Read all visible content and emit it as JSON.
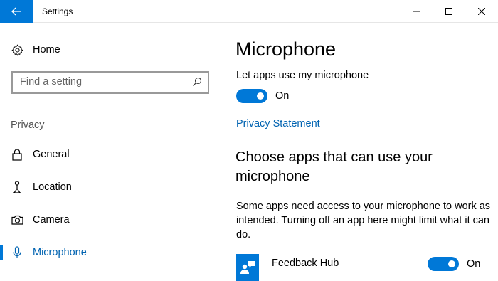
{
  "window": {
    "title": "Settings",
    "back_icon": "arrow-left-icon",
    "minimize_icon": "minimize-icon",
    "maximize_icon": "maximize-icon",
    "close_icon": "close-icon"
  },
  "sidebar": {
    "home": {
      "label": "Home",
      "icon": "gear-icon"
    },
    "search": {
      "placeholder": "Find a setting",
      "value": "",
      "icon": "search-icon"
    },
    "section_label": "Privacy",
    "items": [
      {
        "label": "General",
        "icon": "lock-icon",
        "active": false
      },
      {
        "label": "Location",
        "icon": "location-person-icon",
        "active": false
      },
      {
        "label": "Camera",
        "icon": "camera-icon",
        "active": false
      },
      {
        "label": "Microphone",
        "icon": "microphone-icon",
        "active": true
      }
    ]
  },
  "main": {
    "title": "Microphone",
    "master_setting": {
      "label": "Let apps use my microphone",
      "state": "On",
      "enabled": true
    },
    "privacy_link": "Privacy Statement",
    "apps_heading": "Choose apps that can use your microphone",
    "apps_description": "Some apps need access to your microphone to work as intended. Turning off an app here might limit what it can do.",
    "apps": [
      {
        "name": "Feedback Hub",
        "icon": "feedback-hub-icon",
        "state": "On",
        "enabled": true
      }
    ]
  },
  "colors": {
    "accent": "#0078d7",
    "link": "#0063b1",
    "toggle_on": "#0078d7"
  }
}
